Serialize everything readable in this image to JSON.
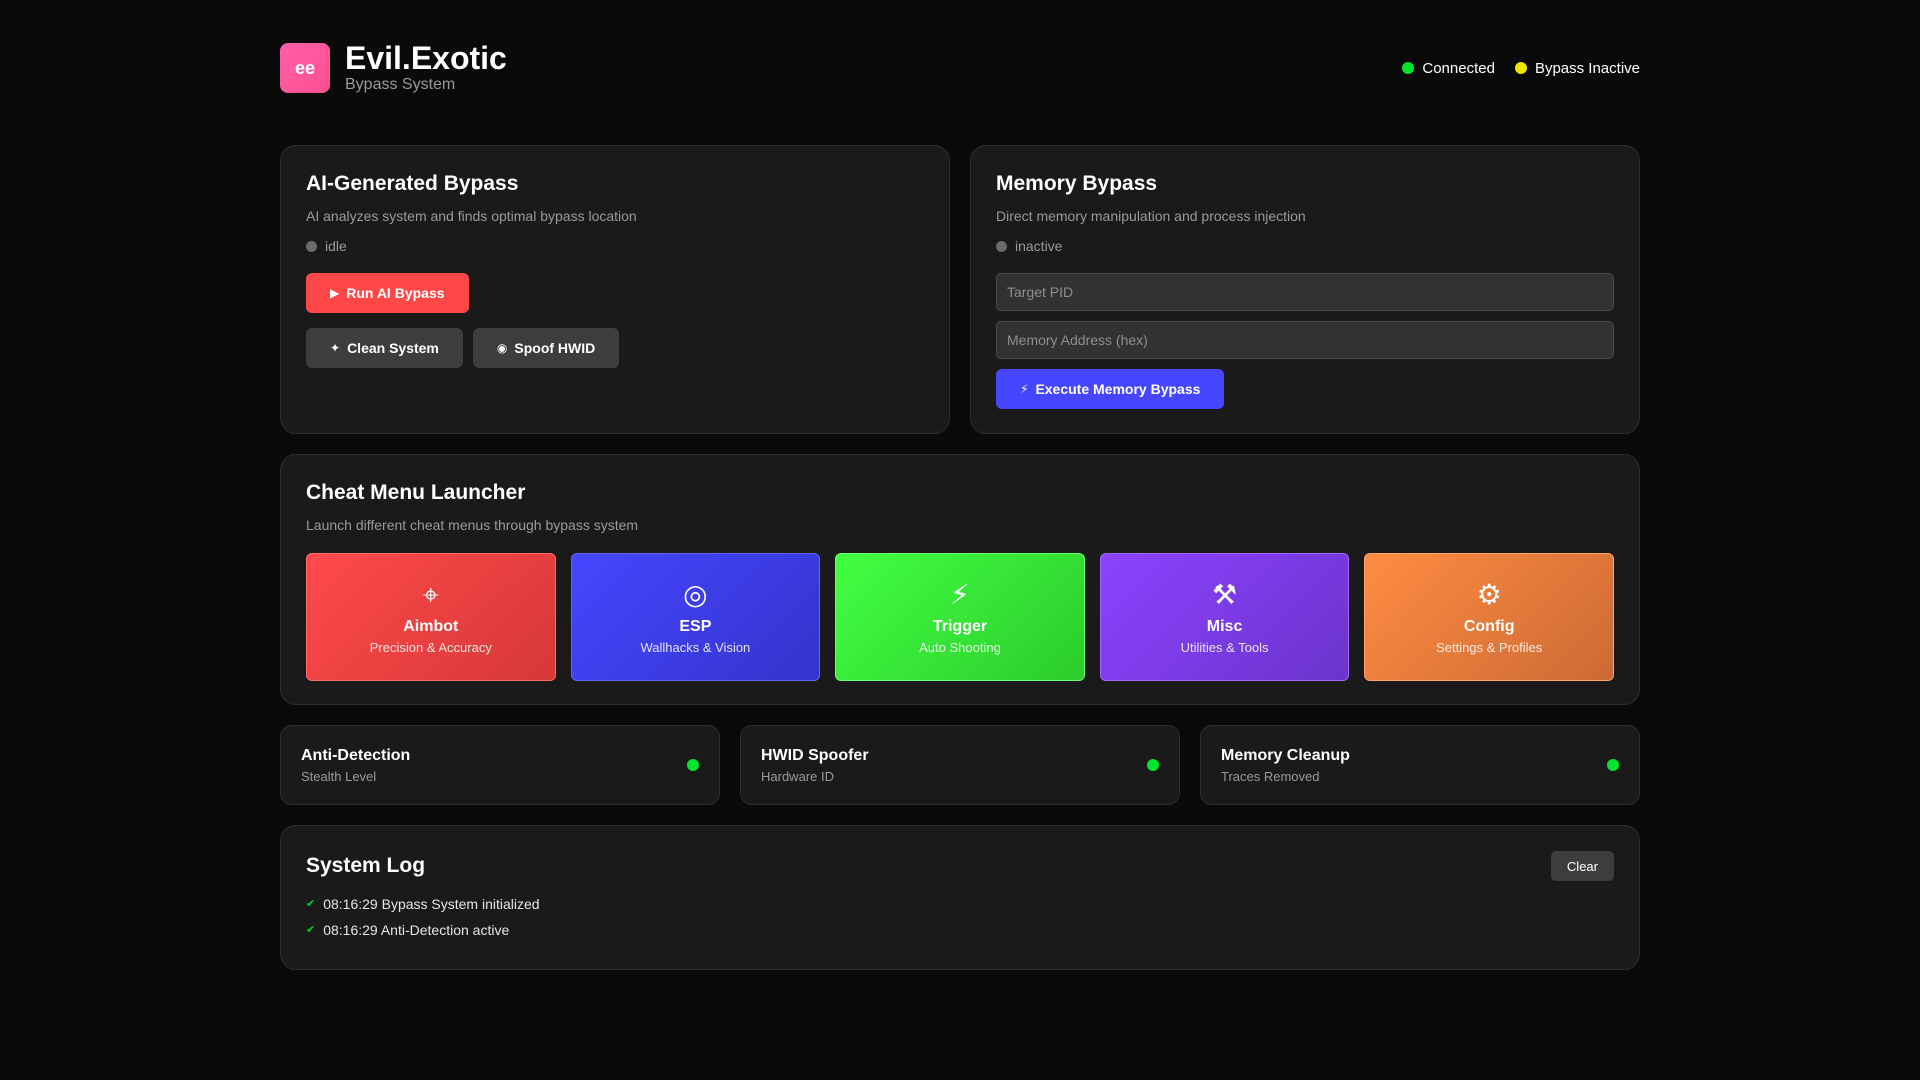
{
  "header": {
    "logo_text": "ee",
    "title": "Evil.Exotic",
    "subtitle": "Bypass System",
    "status": [
      {
        "label": "Connected",
        "color": "#00e62e"
      },
      {
        "label": "Bypass Inactive",
        "color": "#f0e500"
      }
    ]
  },
  "ai_bypass": {
    "title": "AI-Generated Bypass",
    "description": "AI analyzes system and finds optimal bypass location",
    "state": "idle",
    "run_label": "Run AI Bypass",
    "clean_label": "Clean System",
    "spoof_label": "Spoof HWID",
    "icons": {
      "run": "robot-icon",
      "clean": "broom-icon",
      "spoof": "fingerprint-icon"
    }
  },
  "memory_bypass": {
    "title": "Memory Bypass",
    "description": "Direct memory manipulation and process injection",
    "state": "inactive",
    "pid_placeholder": "Target PID",
    "address_placeholder": "Memory Address (hex)",
    "execute_label": "Execute Memory Bypass",
    "icons": {
      "execute": "bolt-icon"
    }
  },
  "launcher": {
    "title": "Cheat Menu Launcher",
    "description": "Launch different cheat menus through bypass system",
    "tiles": [
      {
        "name": "Aimbot",
        "sub": "Precision & Accuracy",
        "icon": "crosshair-icon",
        "color": "#ff4a4a"
      },
      {
        "name": "ESP",
        "sub": "Wallhacks & Vision",
        "icon": "eye-icon",
        "color": "#4646ff"
      },
      {
        "name": "Trigger",
        "sub": "Auto Shooting",
        "icon": "bolt-icon",
        "color": "#42ff42"
      },
      {
        "name": "Misc",
        "sub": "Utilities & Tools",
        "icon": "wrench-icon",
        "color": "#8c42ff"
      },
      {
        "name": "Config",
        "sub": "Settings & Profiles",
        "icon": "gear-icon",
        "color": "#ff8c42"
      }
    ]
  },
  "features": [
    {
      "title": "Anti-Detection",
      "sub": "Stealth Level",
      "status_color": "#00e62e"
    },
    {
      "title": "HWID Spoofer",
      "sub": "Hardware ID",
      "status_color": "#00e62e"
    },
    {
      "title": "Memory Cleanup",
      "sub": "Traces Removed",
      "status_color": "#00e62e"
    }
  ],
  "log": {
    "title": "System Log",
    "clear_label": "Clear",
    "entries": [
      {
        "text": "08:16:29 Bypass System initialized",
        "icon": "check-icon"
      },
      {
        "text": "08:16:29 Anti-Detection active",
        "icon": "check-icon"
      }
    ]
  }
}
